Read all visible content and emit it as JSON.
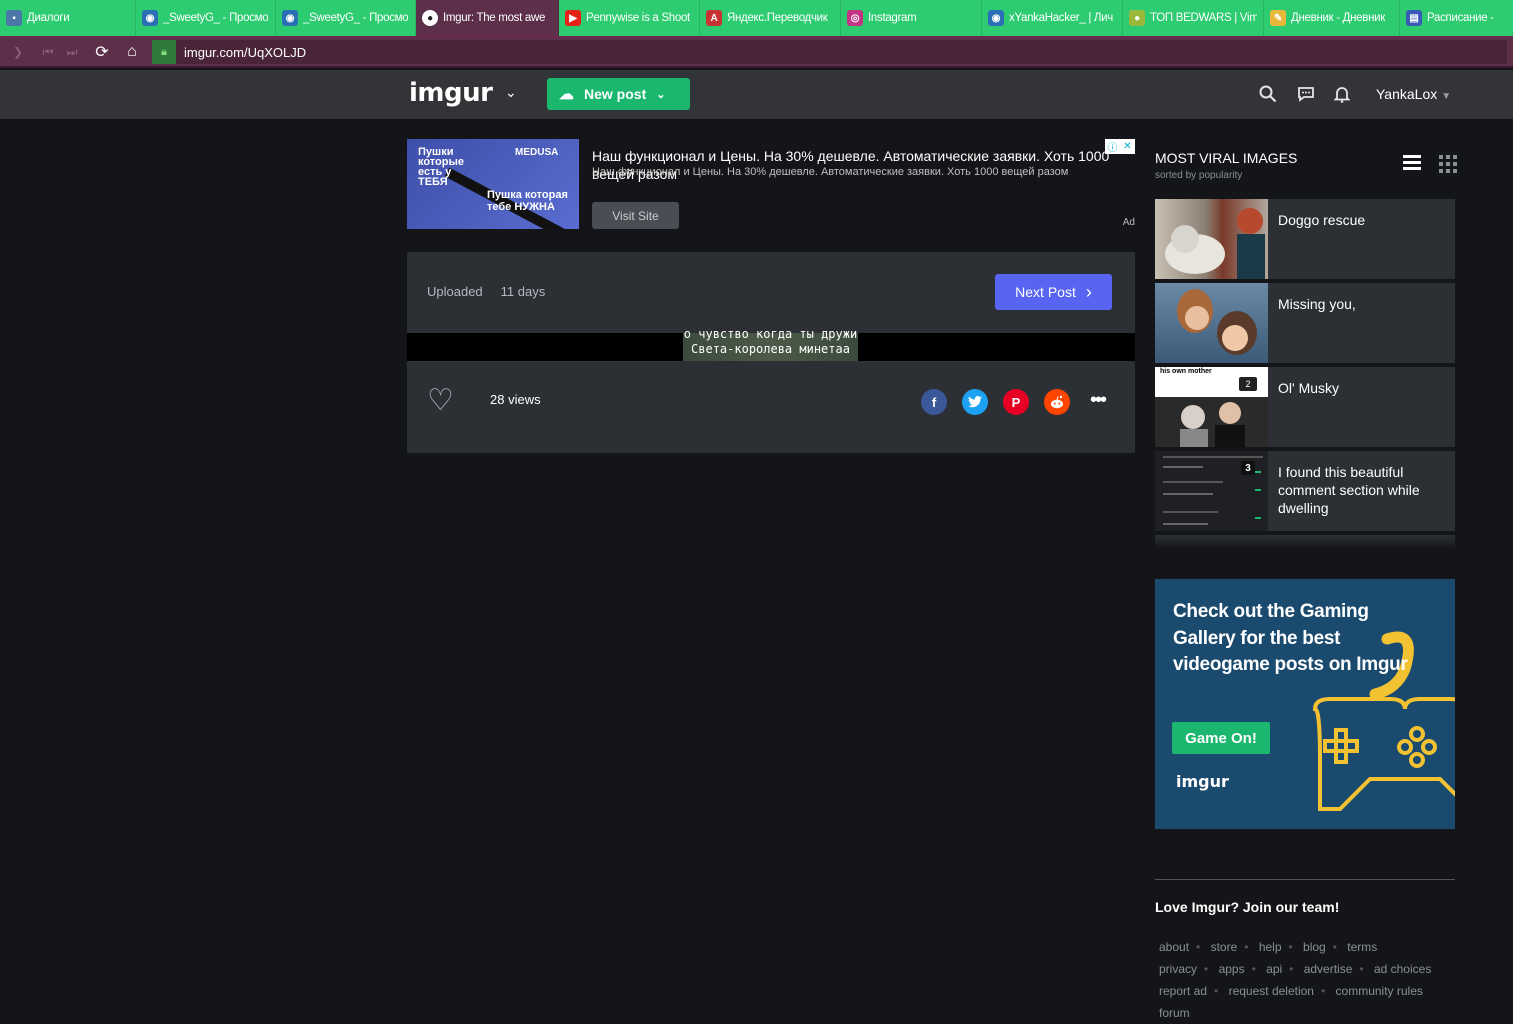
{
  "browser": {
    "tabs": [
      {
        "title": "Диалоги",
        "icon": "vk-message-icon",
        "color": "#4a76a8"
      },
      {
        "title": "_SweetyG_ - Просмо",
        "icon": "owl-icon",
        "color": "#2a6fb5"
      },
      {
        "title": "_SweetyG_ - Просмо",
        "icon": "owl-icon",
        "color": "#2a6fb5"
      },
      {
        "title": "Imgur: The most awe",
        "icon": "imgur-icon",
        "color": "#222"
      },
      {
        "title": "Pennywise is a Shoot",
        "icon": "youtube-icon",
        "color": "#e62117"
      },
      {
        "title": "Яндекс.Переводчик",
        "icon": "yandex-translate-icon",
        "color": "#c83232"
      },
      {
        "title": "Instagram",
        "icon": "instagram-icon",
        "color": "#c13584"
      },
      {
        "title": "xYankaHacker_ | Лич",
        "icon": "owl-icon",
        "color": "#2a6fb5"
      },
      {
        "title": "ТОП BEDWARS | Vim",
        "icon": "pear-icon",
        "color": "#9ab83a"
      },
      {
        "title": "Дневник - Дневник",
        "icon": "diary-icon",
        "color": "#e8b83a"
      },
      {
        "title": "Расписание - G",
        "icon": "schedule-icon",
        "color": "#3a5ab8"
      }
    ],
    "url": "imgur.com/UqXOLJD"
  },
  "header": {
    "logo": "imgur",
    "new_post": "New post",
    "username": "YankaLox"
  },
  "ad": {
    "image_text_1": "Пушки которые есть у ТЕБЯ",
    "image_text_2": "MEDUSA",
    "image_text_3": "Пушка которая тебе НУЖНА",
    "headline": "Наш функционал и Цены. На 30% дешевле. Автоматические заявки. Хоть 1000 вещей разом",
    "subline": "Наш функционал и Цены. На 30% дешевле. Автоматические заявки. Хоть 1000 вещей разом",
    "button": "Visit Site",
    "label": "Ad"
  },
  "post": {
    "uploaded_label": "Uploaded",
    "uploaded_value": "11 days",
    "next_post": "Next Post",
    "caption_line1": "о чувство когда ты дружи",
    "caption_line2": "Света-королева минетаа",
    "views": "28 views"
  },
  "sidebar": {
    "title": "MOST VIRAL IMAGES",
    "subtitle": "sorted by popularity",
    "items": [
      {
        "caption": "Doggo rescue"
      },
      {
        "caption": "Missing you,"
      },
      {
        "caption": "Ol' Musky",
        "thumb_text": "his own mother",
        "badge": "2"
      },
      {
        "caption": "I found this beautiful comment section while dwelling",
        "badge": "3"
      }
    ]
  },
  "promo": {
    "headline": "Check out the Gaming Gallery for the best videogame posts on Imgur",
    "button": "Game On!",
    "brand": "imgur"
  },
  "footer": {
    "join": "Love Imgur? Join our team!",
    "links_row1": [
      "about",
      "store",
      "help",
      "blog",
      "terms"
    ],
    "links_row2": [
      "privacy",
      "apps",
      "api",
      "advertise",
      "ad choices"
    ],
    "links_row3": [
      "report ad",
      "request deletion",
      "community rules"
    ],
    "links_row4": [
      "forum"
    ]
  },
  "colors": {
    "tab_bar": "#2ecc71",
    "address_bar": "#5d2f4a",
    "header": "#323437",
    "page_bg": "#141518",
    "panel": "#2c2f34",
    "green_button": "#1bb76e",
    "next_button": "#5865f2",
    "promo_bg": "#1a4a6e"
  }
}
